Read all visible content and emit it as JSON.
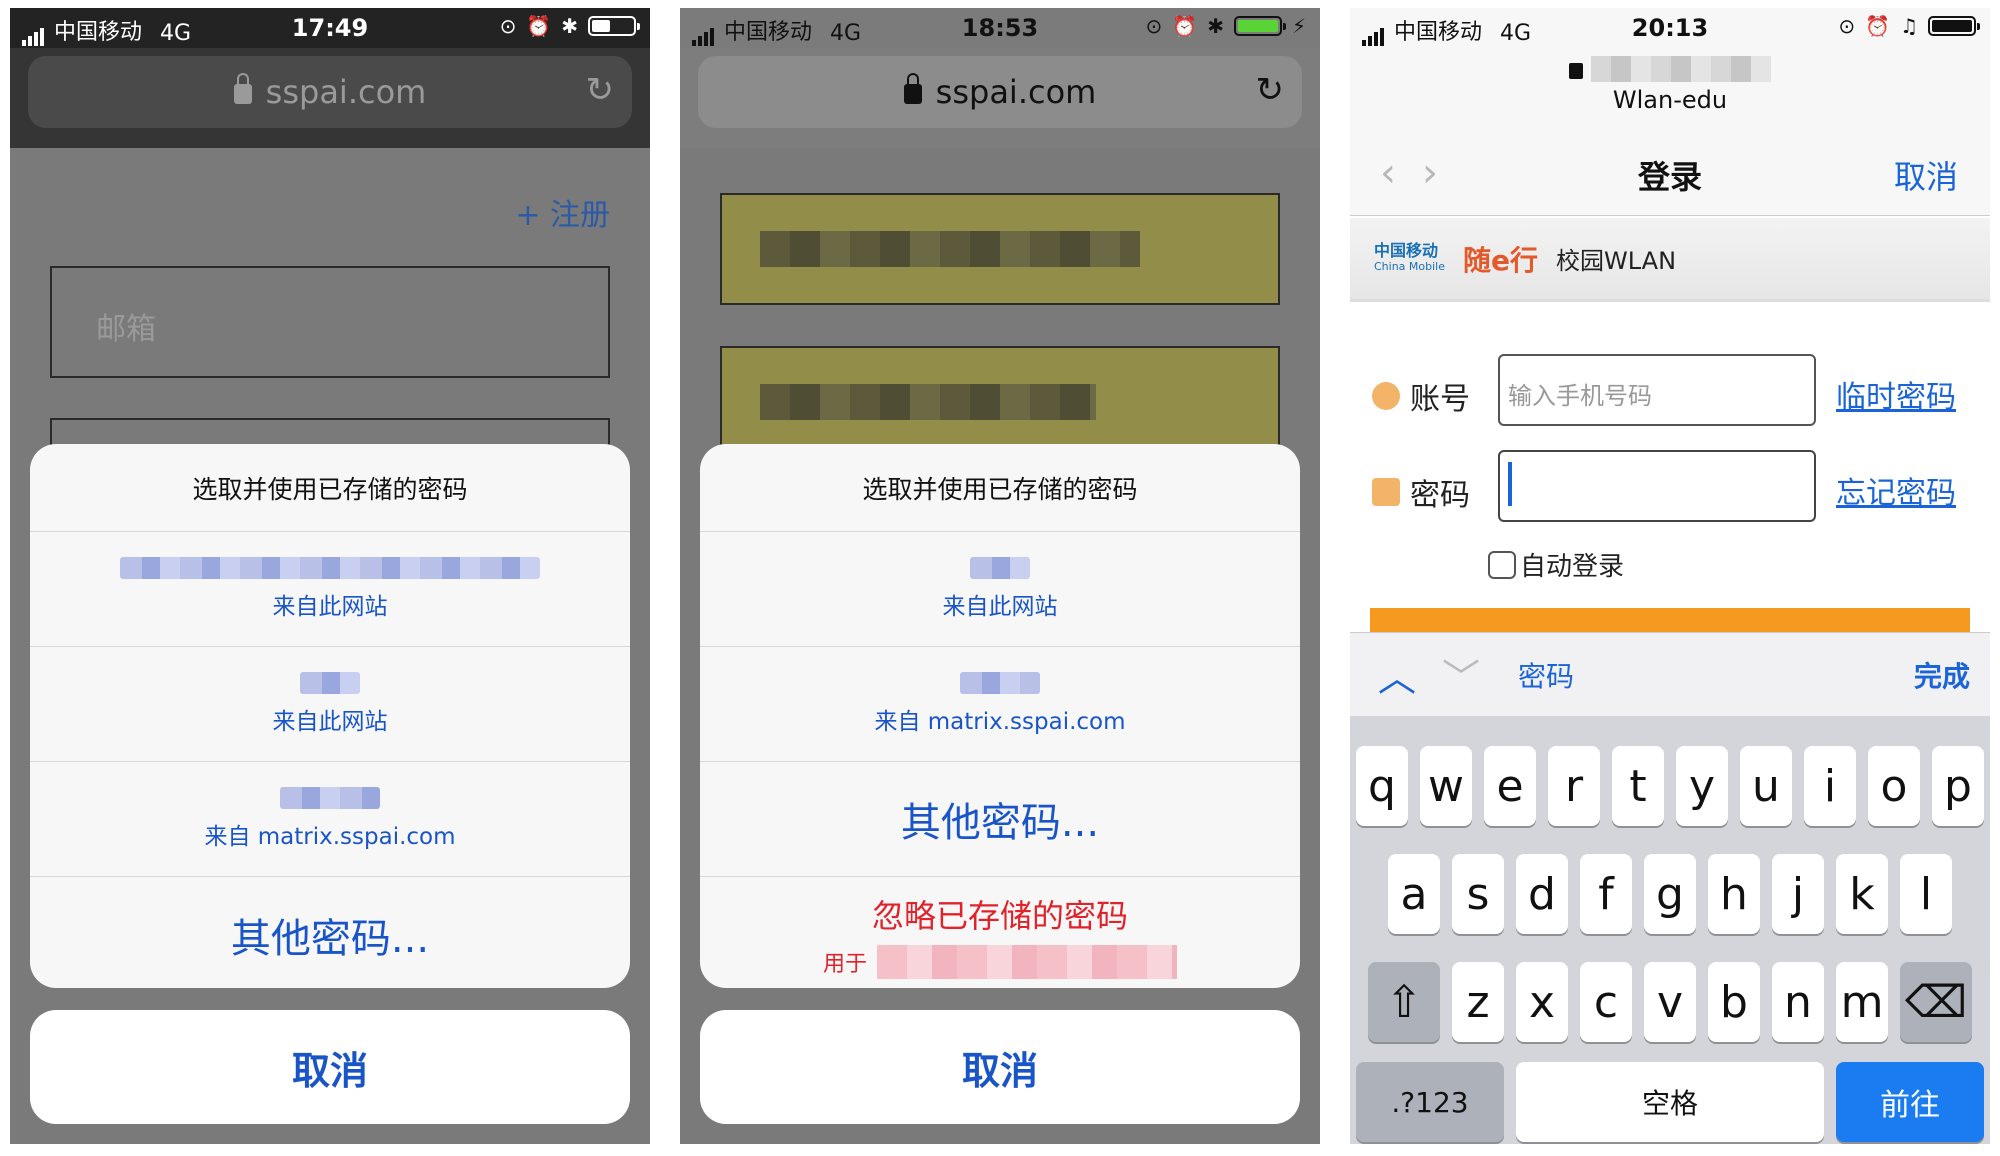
{
  "phone1": {
    "status": {
      "carrier": "中国移动",
      "network": "4G",
      "time": "17:49"
    },
    "url": "sspai.com",
    "register_link": "+ 注册",
    "email_placeholder": "邮箱",
    "sheet_title": "选取并使用已存储的密码",
    "accounts": [
      {
        "source": "来自此网站"
      },
      {
        "source": "来自此网站"
      },
      {
        "source": "来自 matrix.sspai.com"
      }
    ],
    "other_passwords": "其他密码...",
    "cancel": "取消"
  },
  "phone2": {
    "status": {
      "carrier": "中国移动",
      "network": "4G",
      "time": "18:53"
    },
    "url": "sspai.com",
    "sheet_title": "选取并使用已存储的密码",
    "accounts": [
      {
        "source": "来自此网站"
      },
      {
        "source": "来自 matrix.sspai.com"
      }
    ],
    "other_passwords": "其他密码...",
    "ignore_saved": "忽略已存储的密码",
    "used_for": "用于",
    "cancel": "取消"
  },
  "phone3": {
    "status": {
      "carrier": "中国移动",
      "network": "4G",
      "time": "20:13"
    },
    "ssid": "Wlan-edu",
    "nav": {
      "title": "登录",
      "cancel": "取消"
    },
    "banner": {
      "china_mobile": "中国移动",
      "china_mobile_en": "China Mobile",
      "brand": "随e行",
      "campus": "校园WLAN"
    },
    "form": {
      "account_label": "账号",
      "account_placeholder": "输入手机号码",
      "temp_password_link": "临时密码",
      "password_label": "密码",
      "forgot_password_link": "忘记密码",
      "auto_login": "自动登录"
    },
    "accessory": {
      "field_name": "密码",
      "done": "完成"
    },
    "keyboard": {
      "row1": [
        "q",
        "w",
        "e",
        "r",
        "t",
        "y",
        "u",
        "i",
        "o",
        "p"
      ],
      "row2": [
        "a",
        "s",
        "d",
        "f",
        "g",
        "h",
        "j",
        "k",
        "l"
      ],
      "row3": [
        "z",
        "x",
        "c",
        "v",
        "b",
        "n",
        "m"
      ],
      "num_key": ".?123",
      "space": "空格",
      "go": "前往"
    }
  },
  "colors": {
    "ios_blue": "#1a55c8",
    "destructive_red": "#e0232a",
    "keyboard_go": "#1a7cf0",
    "login_bar": "#f59a1e"
  }
}
